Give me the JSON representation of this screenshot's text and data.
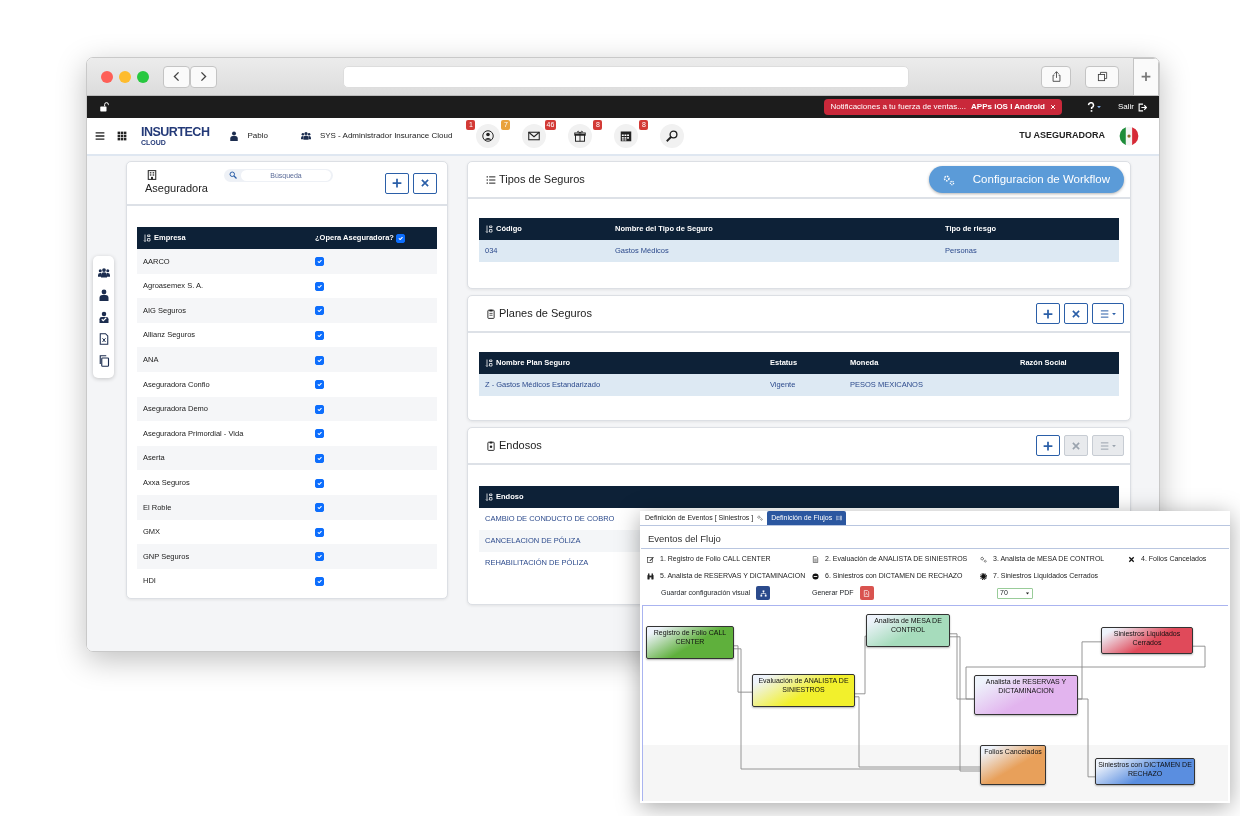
{
  "app_bar": {
    "notification": "Notificaciones a tu fuerza de ventas....",
    "notification_link": "APPs iOS I Android",
    "logout": "Salir"
  },
  "nav": {
    "logo": "INSURTECH",
    "logo_sub": "CLOUD",
    "user": "Pablo",
    "role": "SYS - Administrador Insurance Cloud",
    "company": "TU ASEGURADORA",
    "shortcuts": [
      {
        "kind": "user",
        "badges": [
          {
            "text": "1",
            "color": "#d33a36"
          },
          {
            "text": "7",
            "color": "#e9a23b"
          }
        ]
      },
      {
        "kind": "mail",
        "badges": [
          {
            "text": "46",
            "color": "#d33a36"
          }
        ]
      },
      {
        "kind": "gift",
        "badges": [
          {
            "text": "8",
            "color": "#d33a36"
          }
        ]
      },
      {
        "kind": "calendar",
        "badges": [
          {
            "text": "8",
            "color": "#d33a36"
          }
        ]
      },
      {
        "kind": "search"
      }
    ]
  },
  "insurers": {
    "title": "Aseguradora",
    "search": {
      "placeholder": "Búsqueda"
    },
    "columns": [
      "Empresa",
      "¿Opera Aseguradora?"
    ],
    "all_checked": true,
    "rows": [
      {
        "name": "AARCO",
        "checked": true
      },
      {
        "name": "Agroasemex S. A.",
        "checked": true
      },
      {
        "name": "AIG Seguros",
        "checked": true
      },
      {
        "name": "Allianz Seguros",
        "checked": true
      },
      {
        "name": "ANA",
        "checked": true
      },
      {
        "name": "Aseguradora Confio",
        "checked": true
      },
      {
        "name": "Aseguradora Demo",
        "checked": true
      },
      {
        "name": "Aseguradora Primordial - Vida",
        "checked": true
      },
      {
        "name": "Aserta",
        "checked": true
      },
      {
        "name": "Axxa Seguros",
        "checked": true
      },
      {
        "name": "El Roble",
        "checked": true
      },
      {
        "name": "GMX",
        "checked": true
      },
      {
        "name": "GNP Seguros",
        "checked": true
      },
      {
        "name": "HDI",
        "checked": true
      }
    ]
  },
  "panels": [
    {
      "kind": "types",
      "title": "Tipos de Seguros",
      "action": "Configuracion de Workflow",
      "columns": [
        "Código",
        "Nombre del Tipo de Seguro",
        "Tipo de riesgo"
      ],
      "rows": [
        [
          "034",
          "Gastos Médicos",
          "Personas"
        ]
      ]
    },
    {
      "kind": "plans",
      "title": "Planes de Seguros",
      "buttons": [
        {
          "kind": "add",
          "disabled": false
        },
        {
          "kind": "delete",
          "disabled": false
        },
        {
          "kind": "menu",
          "disabled": false
        }
      ],
      "columns": [
        "Nombre Plan Seguro",
        "Estatus",
        "Moneda",
        "Razón Social"
      ],
      "rows": [
        [
          "Z - Gastos Médicos Estandarizado",
          "Vigente",
          "PESOS MEXICANOS"
        ]
      ]
    },
    {
      "kind": "endorsements",
      "title": "Endosos",
      "buttons": [
        {
          "kind": "add",
          "disabled": false
        },
        {
          "kind": "delete",
          "disabled": true
        },
        {
          "kind": "menu",
          "disabled": true
        }
      ],
      "columns": [
        "Endoso"
      ],
      "rows": [
        [
          "CAMBIO DE CONDUCTO DE COBRO"
        ],
        [
          "CANCELACION DE PÓLIZA"
        ],
        [
          "REHABILITACIÓN DE PÓLIZA"
        ]
      ]
    }
  ],
  "workflow": {
    "tabs": [
      {
        "label": "Definición de Eventos [ Siniestros ]",
        "kind": "gears",
        "selected": false
      },
      {
        "label": "Definición de Flujos",
        "kind": "flow",
        "selected": true
      }
    ],
    "heading": "Eventos del Flujo",
    "legend": [
      {
        "kind": "edit",
        "label": "1. Registro de Folio CALL CENTER"
      },
      {
        "kind": "document",
        "label": "2. Evaluación de ANALISTA DE SINIESTROS"
      },
      {
        "kind": "gears",
        "label": "3. Analista de MESA DE CONTROL"
      },
      {
        "kind": "cross",
        "label": "4. Folios Cancelados"
      },
      {
        "kind": "binoculars",
        "label": "5. Analista de RESERVAS Y DICTAMINACION"
      },
      {
        "kind": "minus",
        "label": "6. Siniestros con DICTAMEN DE RECHAZO"
      },
      {
        "kind": "cog",
        "label": "7. Siniestros Liquidados Cerrados"
      }
    ],
    "save_label": "Guardar configuración visual",
    "pdf_label": "Generar PDF",
    "zoom": "70",
    "nodes": [
      {
        "label": "Registro de Folio CALL CENTER",
        "color": "#5fb03c"
      },
      {
        "label": "Evaluación de ANALISTA DE SINIESTROS",
        "color": "#f2f02c"
      },
      {
        "label": "Analista de MESA DE CONTROL",
        "color": "#a6dcbc"
      },
      {
        "label": "Siniestros Liquidados Cerrados",
        "color": "#e04a5a"
      },
      {
        "label": "Analista de RESERVAS Y DICTAMINACION",
        "color": "#e2b4ee"
      },
      {
        "label": "Folios Cancelados",
        "color": "#e8a05a"
      },
      {
        "label": "Siniestros con DICTAMEN DE RECHAZO",
        "color": "#5a8ee0"
      }
    ]
  }
}
